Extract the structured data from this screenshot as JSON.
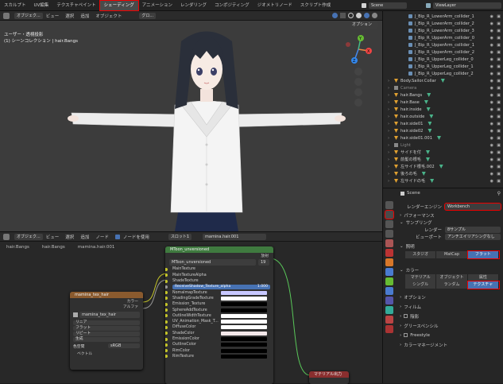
{
  "topbar": {
    "workspaces": [
      "スカルプト",
      "UV編集",
      "テクスチャペイント",
      "シェーディング",
      "アニメーション",
      "レンダリング",
      "コンポジティング",
      "ジオメトリノード",
      "スクリプト作成"
    ],
    "active_workspace": "シェーディング",
    "scene_label": "Scene",
    "view_layer_label": "ViewLayer"
  },
  "viewport": {
    "mode": "オブジェク...",
    "menus": [
      "ビュー",
      "選択",
      "追加",
      "オブジェクト"
    ],
    "transform": "グロ...",
    "options_label": "オプション",
    "info_line1": "ユーザー・透視投影",
    "info_line2": "(1) シーンコレクション | hair.Bangs",
    "axes": {
      "x": "X",
      "y": "Y",
      "z": "Z"
    }
  },
  "node_editor": {
    "mode": "オブジェク...",
    "menus": [
      "ビュー",
      "選択",
      "追加",
      "ノード"
    ],
    "use_nodes_label": "ノードを使用",
    "slot": "スロット1",
    "material": "mamina.hair.001",
    "breadcrumb": [
      "hair.Bangs",
      "hair.Bangs",
      "mamina.hair.001"
    ],
    "mtoon_node": {
      "title": "MToon_unversioned",
      "output_label": "放射",
      "group_name": "MToon_unversioned",
      "group_users": "19",
      "inputs": [
        "MainTexture",
        "MainTextureAlpha",
        "ShadeTexture",
        "ReceiveShadow_Texture_alpha",
        "NomalmapTexture",
        "ShadingGradeTexture",
        "Emission_Texture",
        "SphereAddTexture",
        "OutlineWidthTexture",
        "UV_Animation_Mask_T...",
        "DiffuseColor",
        "ShadeColor",
        "EmissionColor",
        "OutlineColor",
        "RimColor",
        "RimTexture"
      ],
      "receive_value": "1.000"
    },
    "tex_node": {
      "title": "mamina_tex_hair",
      "outputs": [
        "カラー",
        "アルファ"
      ],
      "image_name": "mamina_tex_hair",
      "dropdowns": [
        "リニア",
        "フラット",
        "リピート",
        "生成"
      ],
      "colorspace_label": "色空間",
      "colorspace_value": "sRGB",
      "vector_label": "ベクトル"
    },
    "output_node_title": "マテリアル出力"
  },
  "outliner": {
    "items": [
      {
        "label": "J_Bip_R_LowerArm_collider_1",
        "kind": "bone",
        "indent": 2
      },
      {
        "label": "J_Bip_R_LowerArm_collider_2",
        "kind": "bone",
        "indent": 2
      },
      {
        "label": "J_Bip_R_LowerArm_collider_3",
        "kind": "bone",
        "indent": 2
      },
      {
        "label": "J_Bip_R_UpperArm_collider_0",
        "kind": "bone",
        "indent": 2
      },
      {
        "label": "J_Bip_R_UpperArm_collider_1",
        "kind": "bone",
        "indent": 2
      },
      {
        "label": "J_Bip_R_UpperArm_collider_2",
        "kind": "bone",
        "indent": 2
      },
      {
        "label": "J_Bip_R_UpperLeg_collider_0",
        "kind": "bone",
        "indent": 2
      },
      {
        "label": "J_Bip_R_UpperLeg_collider_1",
        "kind": "bone",
        "indent": 2
      },
      {
        "label": "J_Bip_R_UpperLeg_collider_2",
        "kind": "bone",
        "indent": 2
      },
      {
        "label": "Body.Sailor.Collar",
        "kind": "mesh",
        "indent": 1
      },
      {
        "label": "Camera",
        "kind": "camera",
        "indent": 1
      },
      {
        "label": "hair.Bangs",
        "kind": "mesh",
        "indent": 1
      },
      {
        "label": "hair.Base",
        "kind": "mesh",
        "indent": 1
      },
      {
        "label": "hair.inside",
        "kind": "mesh",
        "indent": 1
      },
      {
        "label": "hair.outside",
        "kind": "mesh",
        "indent": 1
      },
      {
        "label": "hair.side01",
        "kind": "mesh",
        "indent": 1
      },
      {
        "label": "hair.side02",
        "kind": "mesh",
        "indent": 1
      },
      {
        "label": "hair.side01.001",
        "kind": "mesh",
        "indent": 1
      },
      {
        "label": "Light",
        "kind": "light",
        "indent": 1
      },
      {
        "label": "サイドを付",
        "kind": "mesh",
        "indent": 1
      },
      {
        "label": "前髪の根毛",
        "kind": "mesh",
        "indent": 1
      },
      {
        "label": "左サイド根毛.002",
        "kind": "mesh",
        "indent": 1
      },
      {
        "label": "後ろの毛",
        "kind": "mesh",
        "indent": 1
      },
      {
        "label": "左サイドの毛",
        "kind": "mesh",
        "indent": 1
      }
    ]
  },
  "properties": {
    "scene_name": "Scene",
    "render_engine_label": "レンダーエンジン",
    "render_engine_value": "Workbench",
    "sections": {
      "performance": "パフォーマンス",
      "sampling": "サンプリング",
      "lighting": "照明",
      "color": "カラー",
      "options": "オプション",
      "film": "フィルム",
      "shadow": "陰影",
      "grease_pencil": "グリースペンシル",
      "freestyle": "Freestyle",
      "color_management": "カラーマネージメント"
    },
    "render_label": "レンダー",
    "render_value": "8サンプル",
    "viewport_label": "ビューポート",
    "viewport_value": "アンチエイリアシングなし",
    "lighting_options": [
      "スタジオ",
      "MatCap",
      "フラット"
    ],
    "lighting_active": "フラット",
    "color_options_row1": [
      "マテリアル",
      "オブジェクト",
      "属性"
    ],
    "color_options_row2": [
      "シングル",
      "ランダム",
      "テクスチャ"
    ],
    "color_active": "テクスチャ"
  },
  "colors": {
    "accent": "#4772b3",
    "highlight": "#ee0000",
    "node_header_shader": "#3f7a3f",
    "node_header_texture": "#8a5a2e",
    "socket_color": "#c7c729"
  }
}
